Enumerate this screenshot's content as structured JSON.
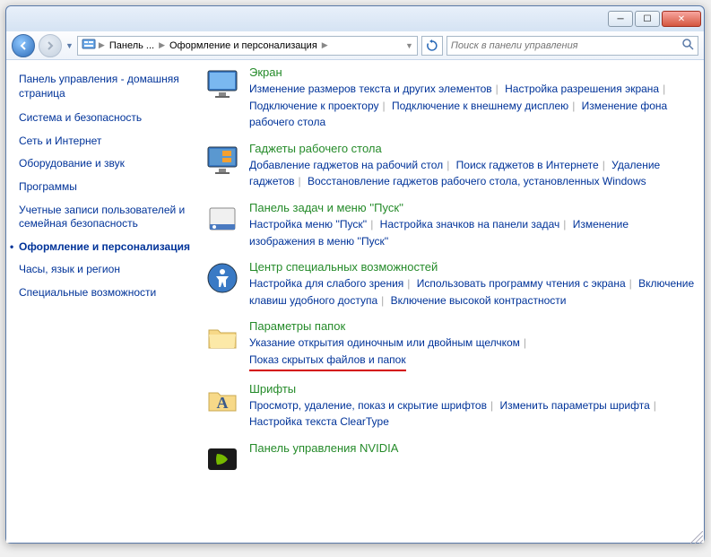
{
  "breadcrumb": {
    "seg1": "Панель ...",
    "seg2": "Оформление и персонализация"
  },
  "search": {
    "placeholder": "Поиск в панели управления"
  },
  "sidebar": {
    "home": "Панель управления - домашняя страница",
    "items": [
      "Система и безопасность",
      "Сеть и Интернет",
      "Оборудование и звук",
      "Программы",
      "Учетные записи пользователей и семейная безопасность",
      "Оформление и персонализация",
      "Часы, язык и регион",
      "Специальные возможности"
    ]
  },
  "cats": {
    "display": {
      "title": "Экран",
      "t0": "Изменение размеров текста и других элементов",
      "t1": "Настройка разрешения экрана",
      "t2": "Подключение к проектору",
      "t3": "Подключение к внешнему дисплею",
      "t4": "Изменение фона рабочего стола"
    },
    "gadgets": {
      "title": "Гаджеты рабочего стола",
      "t0": "Добавление гаджетов на рабочий стол",
      "t1": "Поиск гаджетов в Интернете",
      "t2": "Удаление гаджетов",
      "t3": "Восстановление гаджетов рабочего стола, установленных Windows"
    },
    "taskbar": {
      "title": "Панель задач и меню ''Пуск''",
      "t0": "Настройка меню ''Пуск''",
      "t1": "Настройка значков на панели задач",
      "t2": "Изменение изображения в меню ''Пуск''"
    },
    "ease": {
      "title": "Центр специальных возможностей",
      "t0": "Настройка для слабого зрения",
      "t1": "Использовать программу чтения с экрана",
      "t2": "Включение клавиш удобного доступа",
      "t3": "Включение высокой контрастности"
    },
    "folder": {
      "title": "Параметры папок",
      "t0": "Указание открытия одиночным или двойным щелчком",
      "t1": "Показ скрытых файлов и папок"
    },
    "fonts": {
      "title": "Шрифты",
      "t0": "Просмотр, удаление, показ и скрытие шрифтов",
      "t1": "Изменить параметры шрифта",
      "t2": "Настройка текста ClearType"
    },
    "nvidia": {
      "title": "Панель управления NVIDIA"
    }
  }
}
